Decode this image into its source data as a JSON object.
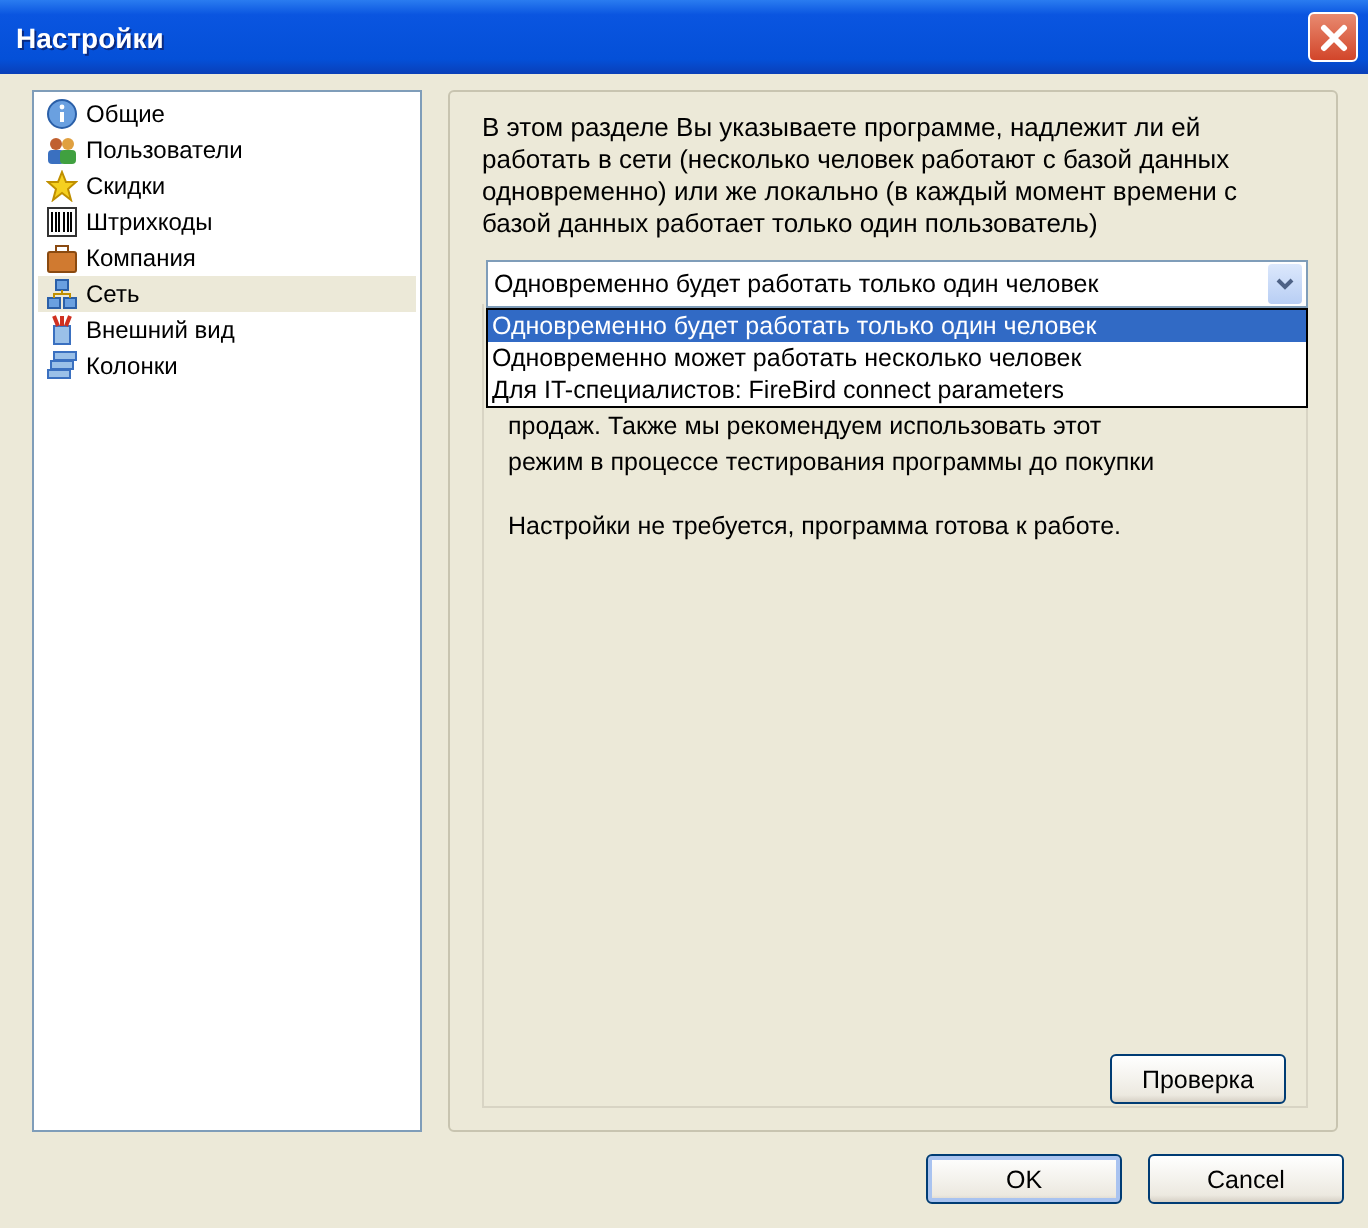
{
  "window": {
    "title": "Настройки"
  },
  "sidebar": {
    "items": [
      {
        "label": "Общие",
        "selected": false
      },
      {
        "label": "Пользователи",
        "selected": false
      },
      {
        "label": "Скидки",
        "selected": false
      },
      {
        "label": "Штрихкоды",
        "selected": false
      },
      {
        "label": "Компания",
        "selected": false
      },
      {
        "label": "Сеть",
        "selected": true
      },
      {
        "label": "Внешний вид",
        "selected": false
      },
      {
        "label": "Колонки",
        "selected": false
      }
    ]
  },
  "panel": {
    "description": "В этом разделе Вы указываете программе, надлежит ли ей работать в сети (несколько человек работают с базой данных одновременно) или же локально (в каждый момент времени с базой данных работает только один пользователь)",
    "mode_select": {
      "value": "Одновременно будет работать только один человек",
      "expanded": true,
      "options": [
        {
          "label": "Одновременно будет работать только один человек",
          "selected": true
        },
        {
          "label": "Одновременно может работать несколько человек",
          "selected": false
        },
        {
          "label": "Для IT-специалистов: FireBird connect parameters",
          "selected": false
        }
      ]
    },
    "info_lines": [
      "продаж. Также мы рекомендуем использовать этот",
      "режим в процессе тестирования программы до покупки"
    ],
    "status_text": "Настройки не требуется, программа готова к работе.",
    "check_button": "Проверка"
  },
  "buttons": [
    "OK",
    "Cancel"
  ]
}
